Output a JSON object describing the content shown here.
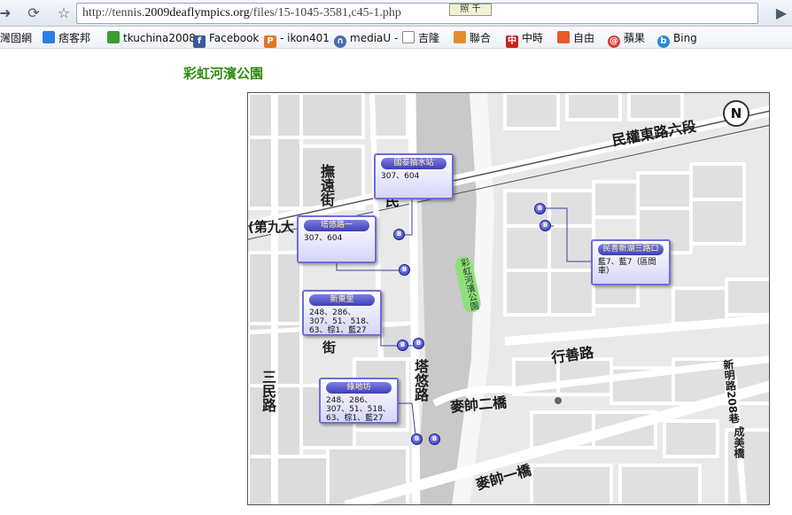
{
  "browser": {
    "url_prefix": "http://tennis.",
    "url_domain": "2009deaflympics.org",
    "url_path": "/files/15-1045-3581,c45",
    "url_tail": "-1.php",
    "url_tooltip": "照 千",
    "icons": {
      "back": "back-arrow-icon",
      "reload": "reload-icon",
      "star": "star-icon",
      "menu": "page-menu-icon"
    }
  },
  "bookmarks": [
    {
      "label": "灣固網",
      "icon": "cube-icon",
      "color": "#3a6fd8"
    },
    {
      "label": "痞客邦",
      "icon": "chat-icon",
      "color": "#2a7de1"
    },
    {
      "label": "tkuchina2008",
      "icon": "folder-icon",
      "color": "#3d9c2f"
    },
    {
      "label": "Facebook",
      "icon": "facebook-icon",
      "color": "#3b5998"
    },
    {
      "label": "- ikon401",
      "icon": "p-icon",
      "color": "#e57628"
    },
    {
      "label": "mediaU -",
      "icon": "headphones-icon",
      "color": "#4b6ab0"
    },
    {
      "label": "吉隆",
      "icon": "page-icon",
      "color": "#ffffff"
    },
    {
      "label": "聯合",
      "icon": "udn-icon",
      "color": "#e58d2a"
    },
    {
      "label": "中時",
      "icon": "chinatimes-icon",
      "color": "#cc2222"
    },
    {
      "label": "自由",
      "icon": "ltn-icon",
      "color": "#e85b2b"
    },
    {
      "label": "蘋果",
      "icon": "apple-daily-icon",
      "color": "#d83a3a"
    },
    {
      "label": "Bing",
      "icon": "bing-icon",
      "color": "#2a8ad6"
    }
  ],
  "page": {
    "title": "彩虹河濱公園"
  },
  "map": {
    "stops": [
      {
        "name": "國泰抽水站",
        "routes": "307、604"
      },
      {
        "name": "塔悠路一",
        "routes": "307、604"
      },
      {
        "name": "新東里",
        "routes": "248、286、307、51、518、63、棕1、藍27"
      },
      {
        "name": "綠地坊",
        "routes": "248、286、307、51、518、63、棕1、藍27"
      },
      {
        "name": "民善新湖三路口",
        "routes": "藍7、藍7（區間車）"
      }
    ],
    "bus_pin_label": "B",
    "streets": {
      "minquan": "民權東路六段",
      "fuyuan": "撫遠街",
      "min": "民",
      "ninth": "(第九大",
      "jie": "街",
      "sanmin": "三民路",
      "tayou": "塔悠路",
      "maishuai2": "麥帥二橋",
      "xingshan": "行善路",
      "xinming": "新明路208巷",
      "chengmei": "成美橋",
      "maishuai1": "麥帥一橋"
    },
    "park_label": "彩虹河濱公園",
    "north_label": "N",
    "colors": {
      "river": "#c9c9c9",
      "road": "#ffffff",
      "block": "#e3e3e3",
      "stop_border": "#6d6fd6"
    }
  }
}
